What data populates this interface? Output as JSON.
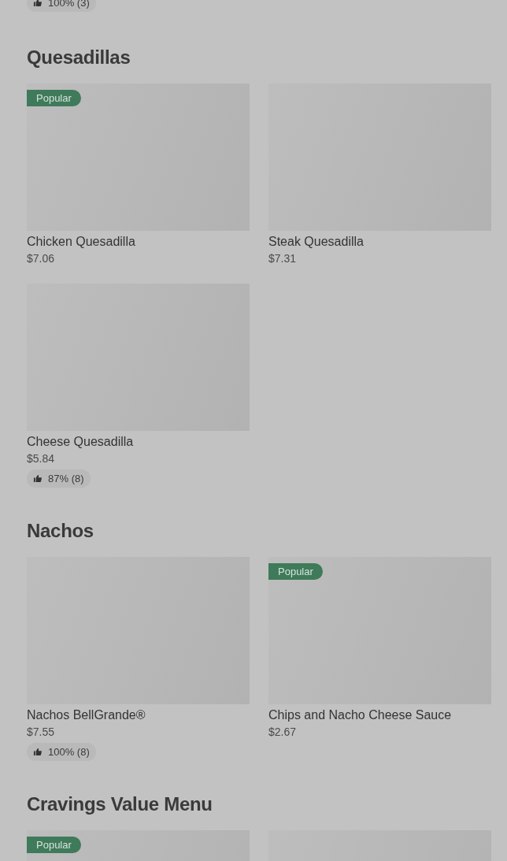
{
  "top_rating": "100% (3)",
  "sections": [
    {
      "title": "Quesadillas",
      "items": [
        {
          "kind": "card",
          "name": "Chicken Quesadilla",
          "price": "$7.06",
          "badge": "Popular"
        },
        {
          "kind": "card",
          "name": "Steak Quesadilla",
          "price": "$7.31"
        },
        {
          "kind": "card",
          "name": "Cheese Quesadilla",
          "price": "$5.84",
          "rating": "87% (8)"
        }
      ]
    },
    {
      "title": "Nachos",
      "items": [
        {
          "kind": "card",
          "name": "Nachos BellGrande®",
          "price": "$7.55",
          "rating": "100% (8)"
        },
        {
          "kind": "card",
          "name": "Chips and Nacho Cheese Sauce",
          "price": "$2.67",
          "badge": "Popular"
        }
      ]
    },
    {
      "title": "Cravings Value Menu",
      "items": [
        {
          "kind": "card",
          "badge": "Popular"
        },
        {
          "kind": "card"
        }
      ]
    }
  ]
}
